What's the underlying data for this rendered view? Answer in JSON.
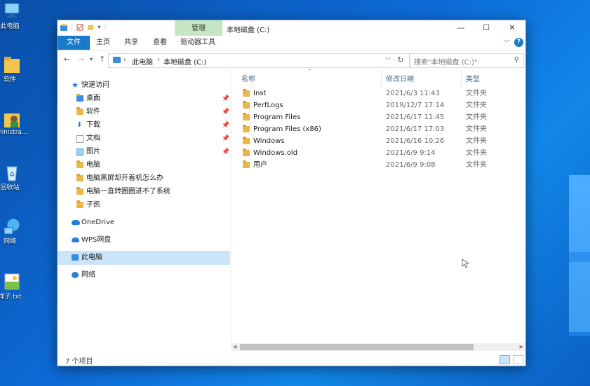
{
  "desktop": {
    "icons": [
      {
        "label": "此电脑",
        "icon": "pc-icon"
      },
      {
        "label": "软件",
        "icon": "folder-icon"
      },
      {
        "label": "ministra...",
        "icon": "user-folder-icon"
      },
      {
        "label": "回收站",
        "icon": "recycle-bin-icon"
      },
      {
        "label": "网络",
        "icon": "network-icon"
      },
      {
        "label": "样子.txt",
        "icon": "text-file-icon"
      }
    ]
  },
  "window": {
    "title": "本地磁盘 (C:)",
    "tool_tab": "管理",
    "controls": {
      "minimize": "—",
      "maximize": "☐",
      "close": "✕"
    },
    "ribbon_tabs": [
      "文件",
      "主页",
      "共享",
      "查看",
      "驱动器工具"
    ],
    "help": "?"
  },
  "address": {
    "crumbs": [
      "此电脑",
      "本地磁盘 (C:)"
    ],
    "search_placeholder": "搜索\"本地磁盘 (C:)\""
  },
  "nav": {
    "quick_access": "快速访问",
    "items": [
      {
        "label": "桌面",
        "pinned": true
      },
      {
        "label": "软件",
        "pinned": true
      },
      {
        "label": "下载",
        "pinned": true
      },
      {
        "label": "文档",
        "pinned": true
      },
      {
        "label": "图片",
        "pinned": true
      },
      {
        "label": "电脑",
        "pinned": false
      },
      {
        "label": "电脑黑屏却开着机怎么办",
        "pinned": false
      },
      {
        "label": "电脑一直转圈圈进不了系统",
        "pinned": false
      },
      {
        "label": "子凯",
        "pinned": false
      }
    ],
    "onedrive": "OneDrive",
    "wps": "WPS网盘",
    "this_pc": "此电脑",
    "network": "网络"
  },
  "columns": {
    "name": "名称",
    "date": "修改日期",
    "type": "类型"
  },
  "files": [
    {
      "name": "Inst",
      "date": "2021/6/3 11:43",
      "type": "文件夹"
    },
    {
      "name": "PerfLogs",
      "date": "2019/12/7 17:14",
      "type": "文件夹"
    },
    {
      "name": "Program Files",
      "date": "2021/6/17 11:45",
      "type": "文件夹"
    },
    {
      "name": "Program Files (x86)",
      "date": "2021/6/17 17:03",
      "type": "文件夹"
    },
    {
      "name": "Windows",
      "date": "2021/6/16 10:26",
      "type": "文件夹"
    },
    {
      "name": "Windows.old",
      "date": "2021/6/9 9:14",
      "type": "文件夹"
    },
    {
      "name": "用户",
      "date": "2021/6/9 9:08",
      "type": "文件夹"
    }
  ],
  "status": {
    "count": "7 个项目"
  },
  "colors": {
    "accent": "#1979ca",
    "selection": "#cce4f7",
    "folder": "#e8b94a",
    "tool_tab": "#c5e6c2"
  }
}
